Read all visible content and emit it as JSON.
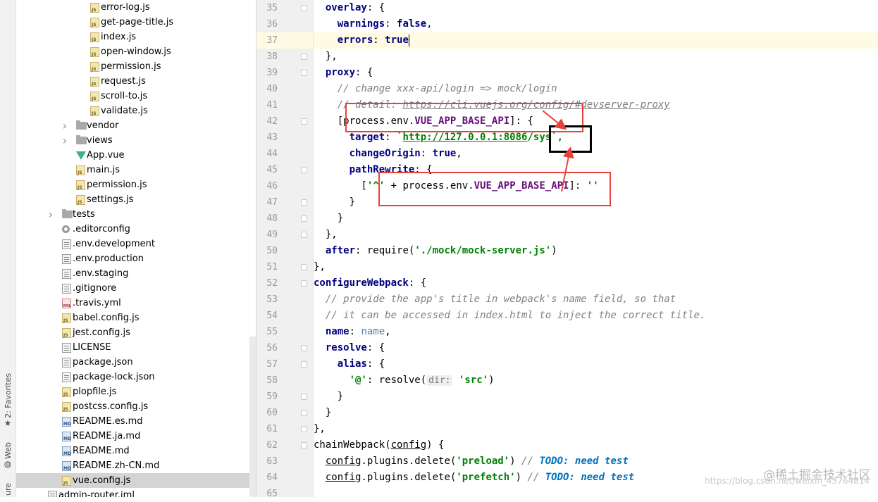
{
  "side_stripe": {
    "favorites_label": "2: Favorites",
    "web_label": "Web",
    "structure_label": "ure"
  },
  "tree": {
    "rows": [
      {
        "label": "error-log.js",
        "icon": "js-file-icon"
      },
      {
        "label": "get-page-title.js",
        "icon": "js-file-icon"
      },
      {
        "label": "index.js",
        "icon": "js-file-icon"
      },
      {
        "label": "open-window.js",
        "icon": "js-file-icon"
      },
      {
        "label": "permission.js",
        "icon": "js-file-icon"
      },
      {
        "label": "request.js",
        "icon": "js-file-icon"
      },
      {
        "label": "scroll-to.js",
        "icon": "js-file-icon"
      },
      {
        "label": "validate.js",
        "icon": "js-file-icon"
      },
      {
        "label": "vendor",
        "icon": "folder-icon"
      },
      {
        "label": "views",
        "icon": "folder-icon"
      },
      {
        "label": "App.vue",
        "icon": "vue-file-icon"
      },
      {
        "label": "main.js",
        "icon": "js-file-icon"
      },
      {
        "label": "permission.js",
        "icon": "js-file-icon"
      },
      {
        "label": "settings.js",
        "icon": "js-file-icon"
      },
      {
        "label": "tests",
        "icon": "folder-icon"
      },
      {
        "label": ".editorconfig",
        "icon": "gear-icon"
      },
      {
        "label": ".env.development",
        "icon": "text-file-icon"
      },
      {
        "label": ".env.production",
        "icon": "text-file-icon"
      },
      {
        "label": ".env.staging",
        "icon": "text-file-icon"
      },
      {
        "label": ".gitignore",
        "icon": "text-file-icon"
      },
      {
        "label": ".travis.yml",
        "icon": "yml-file-icon"
      },
      {
        "label": "babel.config.js",
        "icon": "js-file-icon"
      },
      {
        "label": "jest.config.js",
        "icon": "js-file-icon"
      },
      {
        "label": "LICENSE",
        "icon": "text-file-icon"
      },
      {
        "label": "package.json",
        "icon": "text-file-icon"
      },
      {
        "label": "package-lock.json",
        "icon": "text-file-icon"
      },
      {
        "label": "plopfile.js",
        "icon": "js-file-icon"
      },
      {
        "label": "postcss.config.js",
        "icon": "js-file-icon"
      },
      {
        "label": "README.es.md",
        "icon": "md-file-icon"
      },
      {
        "label": "README.ja.md",
        "icon": "md-file-icon"
      },
      {
        "label": "README.md",
        "icon": "md-file-icon"
      },
      {
        "label": "README.zh-CN.md",
        "icon": "md-file-icon"
      },
      {
        "label": "vue.config.js",
        "icon": "js-file-icon",
        "selected": true
      },
      {
        "label": "admin-router.iml",
        "icon": "text-file-icon"
      }
    ],
    "file_type_tags": {
      "js": "JS",
      "md": "MD",
      "yml": "YML"
    }
  },
  "gutter": {
    "line_numbers": [
      "35",
      "36",
      "37",
      "38",
      "39",
      "40",
      "41",
      "42",
      "43",
      "44",
      "45",
      "46",
      "47",
      "48",
      "49",
      "50",
      "51",
      "52",
      "53",
      "54",
      "55",
      "56",
      "57",
      "58",
      "59",
      "60",
      "61",
      "62",
      "63",
      "64",
      "65"
    ]
  },
  "code": {
    "l35": {
      "key": "overlay",
      "rest": ": {"
    },
    "l36": {
      "key": "warnings",
      "sep": ": ",
      "val": "false",
      "end": ","
    },
    "l37": {
      "key": "errors",
      "sep": ": ",
      "val": "true"
    },
    "l38": {
      "text": "},"
    },
    "l39": {
      "key": "proxy",
      "rest": ": {"
    },
    "l40": {
      "comment": "// change xxx-api/login => mock/login"
    },
    "l41": {
      "comment": "// detail: ",
      "url": "https://cli.vuejs.org/config/#devserver-proxy"
    },
    "l42": {
      "open": "[",
      "obj": "process.env.",
      "prop": "VUE_APP_BASE_API",
      "close": "]: {"
    },
    "l43": {
      "key": "target",
      "sep": ": ",
      "tick": "`",
      "url": "http://127.0.0.1:8086",
      "path": "/sys",
      "end": "`,"
    },
    "l44": {
      "key": "changeOrigin",
      "sep": ": ",
      "val": "true",
      "end": ","
    },
    "l45": {
      "key": "pathRewrite",
      "rest": ": {"
    },
    "l46": {
      "open": "[",
      "str": "'^'",
      "plus": " + ",
      "obj": "process.env.",
      "prop": "VUE_APP_BASE_API",
      "close": "]: ",
      "str2": "''"
    },
    "l47": {
      "text": "}"
    },
    "l48": {
      "text": "}"
    },
    "l49": {
      "text": "},"
    },
    "l50": {
      "key": "after",
      "sep": ": ",
      "fn": "require(",
      "str": "'./mock/mock-server.js'",
      "end": ")"
    },
    "l51": {
      "text": "},"
    },
    "l52": {
      "key": "configureWebpack",
      "rest": ": {"
    },
    "l53": {
      "comment": "// provide the app's title in webpack's name field, so that"
    },
    "l54": {
      "comment": "// it can be accessed in index.html to inject the correct title."
    },
    "l55": {
      "key": "name",
      "sep": ": ",
      "ref": "name",
      "end": ","
    },
    "l56": {
      "key": "resolve",
      "rest": ": {"
    },
    "l57": {
      "key": "alias",
      "rest": ": {"
    },
    "l58": {
      "str": "'@'",
      "sep": ": ",
      "fn": "resolve(",
      "hint": "dir:",
      "str2": "'src'",
      "end": ")"
    },
    "l59": {
      "text": "}"
    },
    "l60": {
      "text": "}"
    },
    "l61": {
      "text": "},"
    },
    "l62": {
      "fn": "chainWebpack(",
      "param": "config",
      "end": ") {"
    },
    "l63": {
      "obj": "config",
      "mid": ".plugins.delete(",
      "str": "'preload'",
      "end": ")",
      "cm": " // ",
      "todo": "TODO: need test"
    },
    "l64": {
      "obj": "config",
      "mid": ".plugins.delete(",
      "str": "'prefetch'",
      "end": ")",
      "cm": " // ",
      "todo": "TODO: need test"
    }
  },
  "annotations": {
    "red_color": "#e8413c",
    "black_color": "#000000"
  },
  "watermark": {
    "site": "@稀土掘金技术社区",
    "blog": "https://blog.csdn.net/weixin_43764814"
  }
}
